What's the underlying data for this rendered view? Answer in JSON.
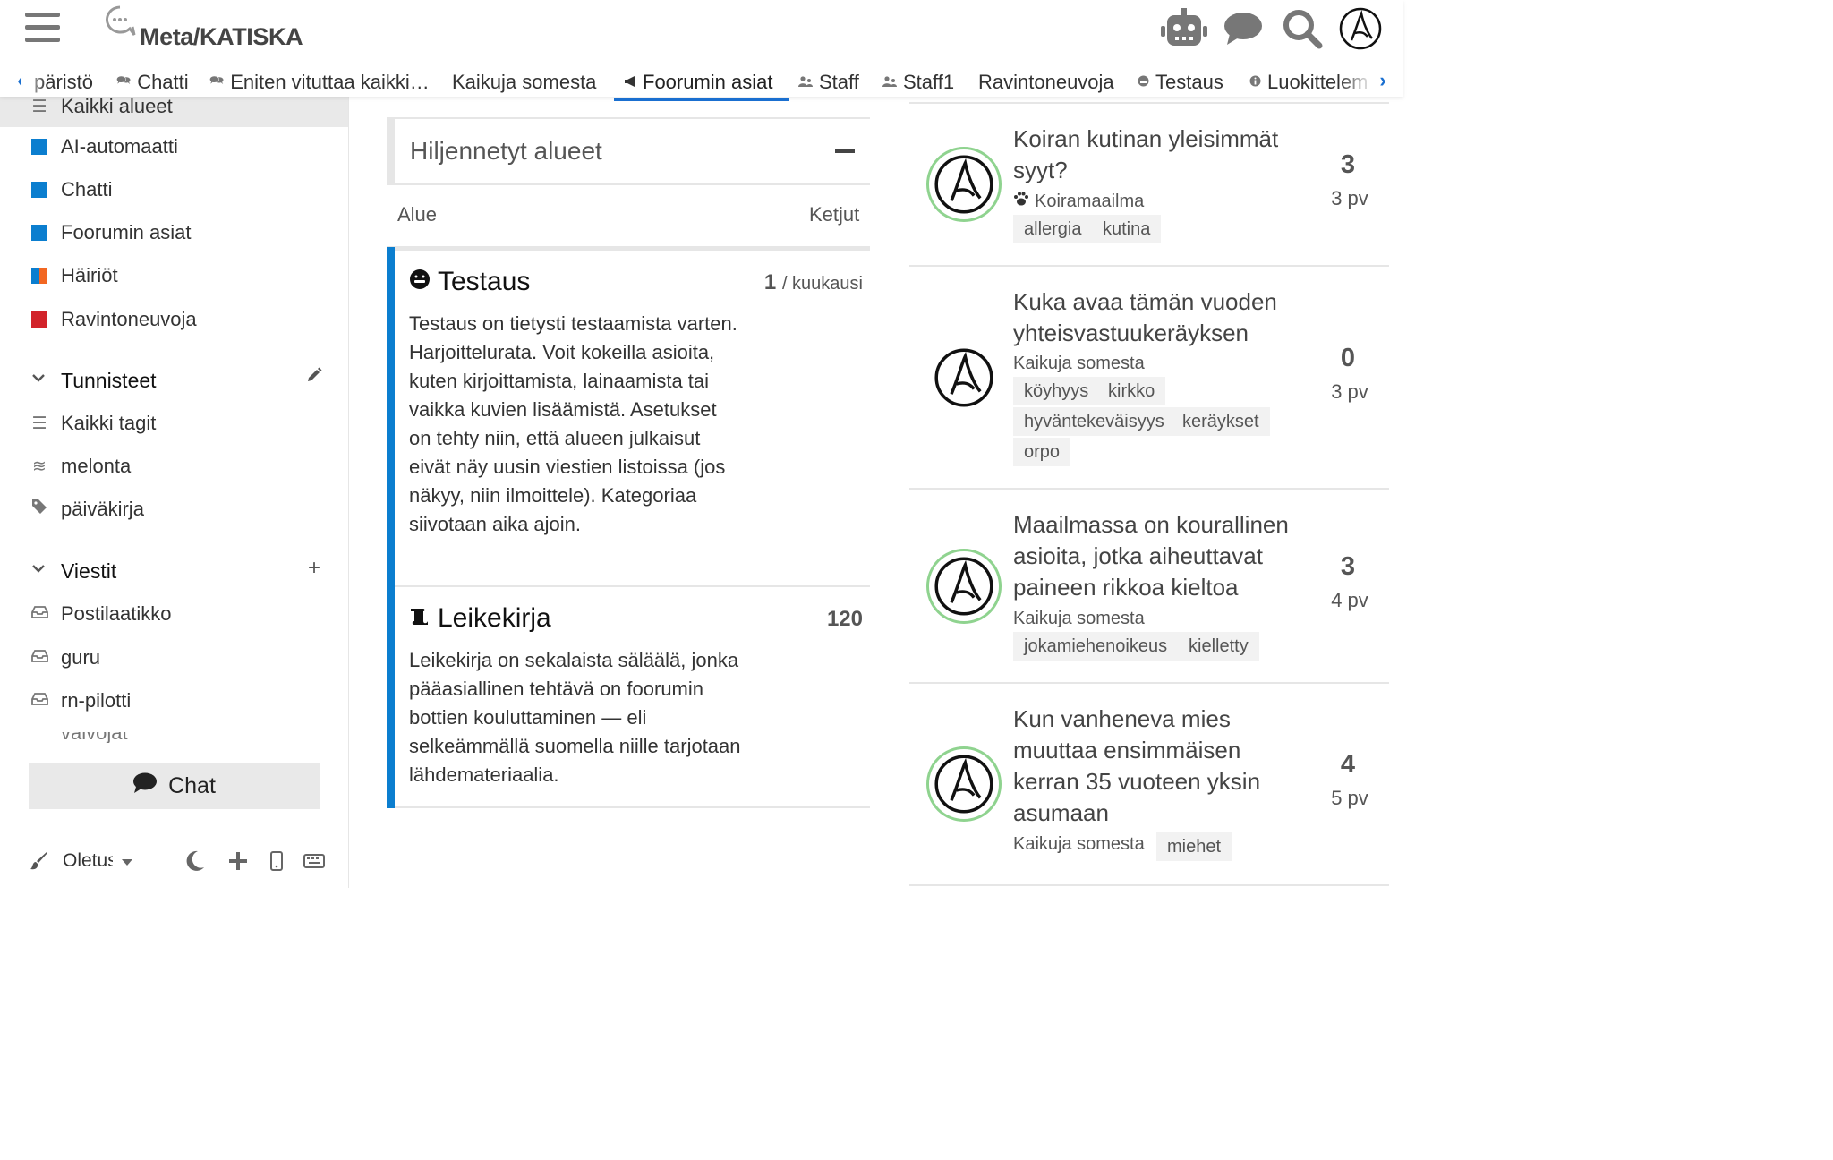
{
  "header": {
    "site_name": "Meta/KATISKA",
    "nav": [
      {
        "label": "päristö",
        "icon": ""
      },
      {
        "label": "Chatti",
        "icon": "comments-icon"
      },
      {
        "label": "Eniten vituttaa kaikki…",
        "icon": "comments-icon"
      },
      {
        "label": "Kaikuja somesta",
        "icon": ""
      },
      {
        "label": "Foorumin asiat",
        "icon": "bullhorn-icon"
      },
      {
        "label": "Staff",
        "icon": "users-icon"
      },
      {
        "label": "Staff1",
        "icon": "users-icon"
      },
      {
        "label": "Ravintoneuvoja",
        "icon": ""
      },
      {
        "label": "Testaus",
        "icon": "face-icon"
      },
      {
        "label": "Luokittelem",
        "icon": "info-icon"
      }
    ],
    "active_nav": "Foorumin asiat",
    "accent": "#1a6fd0"
  },
  "sidebar": {
    "all_categories": "Kaikki alueet",
    "categories": [
      {
        "label": "AI-automaatti",
        "color": "#0b7ecf"
      },
      {
        "label": "Chatti",
        "color": "#0b7ecf"
      },
      {
        "label": "Foorumin asiat",
        "color": "#0b7ecf"
      },
      {
        "label": "Häiriöt",
        "color": "#0b7ecf",
        "color2": "#f26722"
      },
      {
        "label": "Ravintoneuvoja",
        "color": "#d2232a"
      }
    ],
    "tags_section": "Tunnisteet",
    "tags": [
      {
        "label": "Kaikki tagit",
        "icon": "list-icon"
      },
      {
        "label": "melonta",
        "icon": "waves-icon"
      },
      {
        "label": "päiväkirja",
        "icon": "tag-icon"
      }
    ],
    "messages_section": "Viestit",
    "messages": [
      {
        "label": "Postilaatikko",
        "icon": "inbox-icon"
      },
      {
        "label": "guru",
        "icon": "inbox-icon"
      },
      {
        "label": "rn-pilotti",
        "icon": "inbox-icon"
      }
    ],
    "clipped_item": "valvojat",
    "chat_label": "Chat",
    "footer": {
      "theme_label": "Oletus"
    }
  },
  "categories_list": {
    "muted_title": "Hiljennetyt alueet",
    "col_area": "Alue",
    "col_topics": "Ketjut",
    "items": [
      {
        "title": "Testaus",
        "count": "1",
        "per": "/ kuukausi",
        "description": "Testaus on tietysti testaamista varten. Harjoittelurata. Voit kokeilla asioita, kuten kirjoittamista, lainaamista tai vaikka kuvien lisäämistä. Asetukset on tehty niin, että alueen julkaisut eivät näy uusin viestien listoissa (jos näkyy, niin ilmoittele). Kategoriaa siivotaan aika ajoin.",
        "color": "#0b7ecf"
      },
      {
        "title": "Leikekirja",
        "count": "120",
        "per": "",
        "description": "Leikekirja on sekalaista säläälä, jonka pääasiallinen tehtävä on foorumin bottien kouluttaminen — eli selkeämmällä suomella niille tarjotaan lähdemateriaalia.",
        "color": "#0b7ecf"
      }
    ]
  },
  "topics": [
    {
      "title": "Koiran kutinan yleisimmät syyt?",
      "category": "Koiramaailma",
      "tags": [
        "allergia",
        "kutina"
      ],
      "replies": "3",
      "age": "3 pv"
    },
    {
      "title": "Kuka avaa tämän vuoden yhteisvastuukeräyksen",
      "category": "Kaikuja somesta",
      "tags": [
        "köyhyys",
        "kirkko",
        "hyväntekeväisyys",
        "keräykset",
        "orpo"
      ],
      "replies": "0",
      "age": "3 pv"
    },
    {
      "title": "Maailmassa on kourallinen asioita, jotka aiheuttavat paineen rikkoa kieltoa",
      "category": "Kaikuja somesta",
      "tags": [
        "jokamiehenoikeus",
        "kielletty"
      ],
      "replies": "3",
      "age": "4 pv"
    },
    {
      "title": "Kun vanheneva mies muuttaa ensimmäisen kerran 35 vuoteen yksin asumaan",
      "category": "Kaikuja somesta",
      "tags": [
        "miehet"
      ],
      "replies": "4",
      "age": "5 pv"
    }
  ]
}
